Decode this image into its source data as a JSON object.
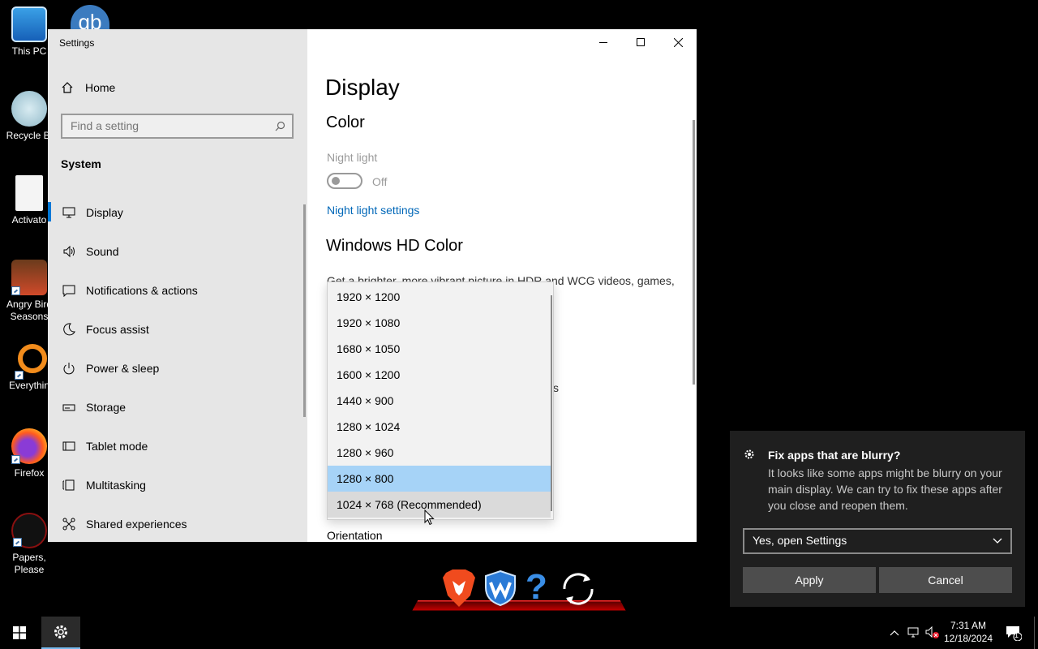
{
  "desktop": {
    "icons": [
      {
        "label": "This PC"
      },
      {
        "label": "Recycle Bi"
      },
      {
        "label": "Activato"
      },
      {
        "label": "Angry Bird\nSeasons"
      },
      {
        "label": "Everythin"
      },
      {
        "label": "Firefox"
      },
      {
        "label": "Papers,\nPlease"
      }
    ],
    "qb_label": "qb"
  },
  "window": {
    "title": "Settings",
    "sidebar": {
      "home_label": "Home",
      "search_placeholder": "Find a setting",
      "section_label": "System",
      "items": [
        {
          "label": "Display",
          "icon": "monitor-icon"
        },
        {
          "label": "Sound",
          "icon": "speaker-icon"
        },
        {
          "label": "Notifications & actions",
          "icon": "message-icon"
        },
        {
          "label": "Focus assist",
          "icon": "moon-icon"
        },
        {
          "label": "Power & sleep",
          "icon": "power-icon"
        },
        {
          "label": "Storage",
          "icon": "drive-icon"
        },
        {
          "label": "Tablet mode",
          "icon": "tablet-icon"
        },
        {
          "label": "Multitasking",
          "icon": "multitask-icon"
        },
        {
          "label": "Shared experiences",
          "icon": "share-icon"
        }
      ]
    },
    "content": {
      "page_title": "Display",
      "color_heading": "Color",
      "night_light_label": "Night light",
      "night_light_state": "Off",
      "night_light_link": "Night light settings",
      "hdr_heading": "Windows HD Color",
      "hdr_text": "Get a brighter, more vibrant picture in HDR and WCG videos, games,",
      "partial_char": "s",
      "orientation_label": "Orientation"
    },
    "resolution_dropdown": {
      "options": [
        "1920 × 1200",
        "1920 × 1080",
        "1680 × 1050",
        "1600 × 1200",
        "1440 × 900",
        "1280 × 1024",
        "1280 × 960",
        "1280 × 800",
        "1024 × 768 (Recommended)"
      ],
      "selected": "1280 × 800",
      "hovered": "1024 × 768 (Recommended)"
    }
  },
  "toast": {
    "title": "Fix apps that are blurry?",
    "body": "It looks like some apps might be blurry on your main display. We can try to fix these apps after you close and reopen them.",
    "select_value": "Yes, open Settings",
    "apply_label": "Apply",
    "cancel_label": "Cancel"
  },
  "taskbar": {
    "time": "7:31 AM",
    "date": "12/18/2024",
    "notification_count": "1"
  },
  "colors": {
    "accent": "#0078d7",
    "selected_option": "#a6d3f7",
    "link": "#0067b8"
  }
}
